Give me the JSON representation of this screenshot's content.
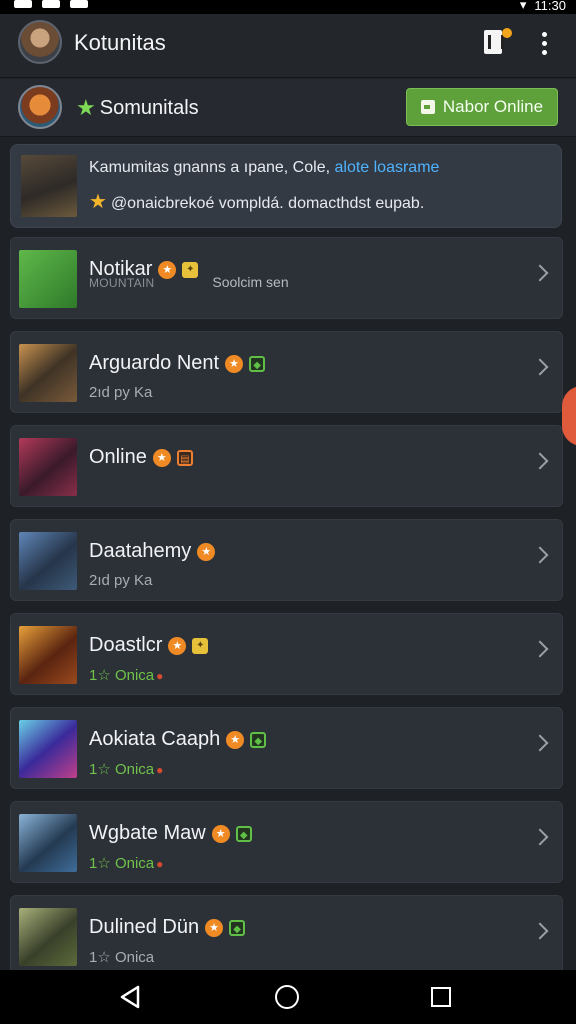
{
  "status_bar": {
    "time": "11:30"
  },
  "header": {
    "title": "Kotunitas",
    "avatar_icon": "user-avatar-icon",
    "filter_icon": "document-filter-icon",
    "more_icon": "more-vertical-icon"
  },
  "community": {
    "title": "Somunitals",
    "star_icon": "star-icon",
    "online_button": "Nabor Online"
  },
  "notice": {
    "line1_text": "Kamumitas gnanns a ıpane, Cole, ",
    "line1_link": "alote loasrame",
    "line2_text": "@onaicbrekoé vompldá. domacthdst eupab."
  },
  "items": [
    {
      "name": "Notikar",
      "caption": "MOUNTAIN",
      "sub": "Soolcim sen",
      "badges": [
        "fire",
        "yellow"
      ],
      "status": "none",
      "thumb": "#4caf50"
    },
    {
      "name": "Arguardo Nent",
      "sub": "2ıd py Ka",
      "badges": [
        "fire",
        "green"
      ],
      "status": "plain",
      "thumb": "#7a5a3a"
    },
    {
      "name": "Online",
      "sub": "",
      "badges": [
        "fire",
        "orange"
      ],
      "status": "none",
      "thumb": "#8a2f4a"
    },
    {
      "name": "Daatahemy",
      "sub": "2ıd py Ka",
      "badges": [
        "fire"
      ],
      "status": "plain",
      "thumb": "#3e5a78"
    },
    {
      "name": "Doastlcr",
      "sub": "1☆ Onica",
      "badges": [
        "fire",
        "yellow"
      ],
      "status": "online",
      "thumb": "#9a4a1e"
    },
    {
      "name": "Aokiata Caaph",
      "sub": "1☆ Onica",
      "badges": [
        "fire",
        "green"
      ],
      "status": "online",
      "thumb": "#4a5fc0"
    },
    {
      "name": "Wgbate Maw",
      "sub": "1☆ Onica",
      "badges": [
        "fire",
        "green"
      ],
      "status": "online",
      "thumb": "#3f6d9a"
    },
    {
      "name": "Dulined Dün",
      "sub": "1☆ Onica",
      "badges": [
        "fire",
        "green"
      ],
      "status": "plain",
      "thumb": "#5c6b3a"
    }
  ],
  "nav": {
    "back_icon": "back-triangle-icon",
    "home_icon": "home-circle-icon",
    "recent_icon": "recent-square-icon"
  }
}
